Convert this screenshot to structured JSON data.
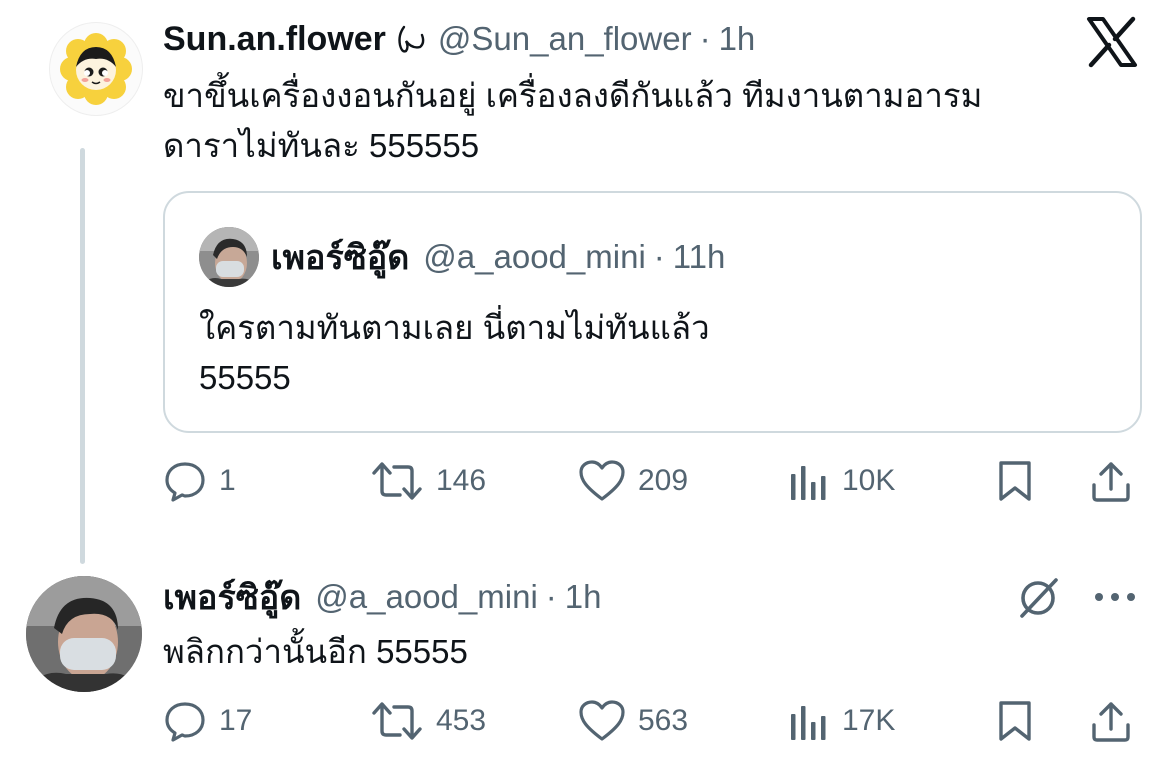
{
  "platform": {
    "logo": "x-logo-icon"
  },
  "original_post": {
    "display_name": "Sun.an.flower",
    "badge_icon": "scribble-badge-icon",
    "handle": "@Sun_an_flower",
    "dot": "·",
    "time": "1h",
    "text_line1": "ขาขึ้นเครื่องงอนกันอยู่ เครื่องลงดีกันแล้ว ทีมงานตามอารม",
    "text_line2": "ดาราไม่ทันละ 555555",
    "quote": {
      "display_name": "เพอร์ซิอู๊ด",
      "handle": "@a_aood_mini",
      "dot": "·",
      "time": "11h",
      "text_line1": "ใครตามทันตามเลย นี่ตามไม่ทันแล้ว",
      "text_line2": "55555"
    },
    "actions": {
      "replies": "1",
      "reposts": "146",
      "likes": "209",
      "views": "10K"
    }
  },
  "reply_post": {
    "display_name": "เพอร์ซิอู๊ด",
    "handle": "@a_aood_mini",
    "dot": "·",
    "time": "1h",
    "text": "พลิกกว่านั้นอีก 55555",
    "actions": {
      "replies": "17",
      "reposts": "453",
      "likes": "563",
      "views": "17K"
    }
  },
  "colors": {
    "text": "#0f1419",
    "muted": "#536471",
    "border": "#cfd9de",
    "avatar_sunflower_petals": "#f7d13d",
    "avatar_sunflower_face": "#fdf3de"
  }
}
